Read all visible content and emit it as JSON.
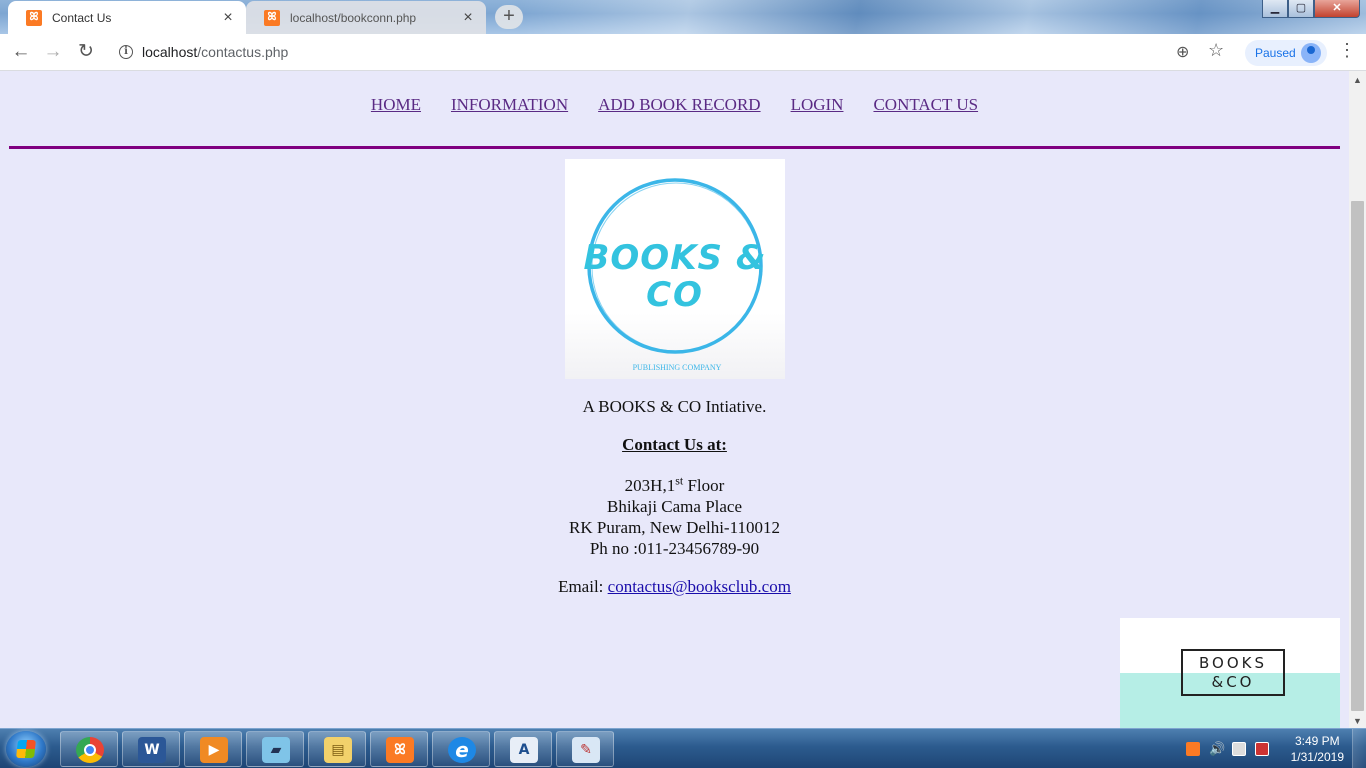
{
  "browser": {
    "tabs": [
      {
        "title": "Contact Us",
        "active": true
      },
      {
        "title": "localhost/bookconn.php",
        "active": false
      }
    ],
    "new_tab_glyph": "+",
    "window_controls": {
      "minimize": "▁",
      "maximize": "▢",
      "close": "✕"
    },
    "url_host": "localhost",
    "url_path": "/contactus.php",
    "profile_status": "Paused"
  },
  "page": {
    "nav": [
      "HOME",
      "INFORMATION",
      "ADD BOOK RECORD",
      "LOGIN",
      "CONTACT US"
    ],
    "logo": {
      "line1": "BOOKS &",
      "line2": "CO",
      "subtitle": "PUBLISHING COMPANY",
      "ring_color": "#3bb6e8"
    },
    "tagline": "A BOOKS & CO Intiative.",
    "contact_heading": "Contact Us at:",
    "address": {
      "line1_prefix": "203H,1",
      "line1_sup": "st",
      "line1_suffix": " Floor",
      "line2": "Bhikaji Cama Place",
      "line3": "RK Puram, New Delhi-110012",
      "line4": "Ph no :011-23456789-90"
    },
    "email_label": "Email: ",
    "email": "contactus@booksclub.com",
    "badge": {
      "line1": "BOOKS",
      "line2": "&CO",
      "accent_color": "#b6eee6"
    },
    "nav_color": "#5a2a84",
    "rule_color": "#800080",
    "background": "#e8e8fa"
  },
  "taskbar": {
    "apps": [
      {
        "name": "chrome",
        "glyph": "◉"
      },
      {
        "name": "word",
        "glyph": "W"
      },
      {
        "name": "media-player",
        "glyph": "▶"
      },
      {
        "name": "notepad",
        "glyph": "▰"
      },
      {
        "name": "explorer",
        "glyph": "▤"
      },
      {
        "name": "xampp",
        "glyph": "ꕤ"
      },
      {
        "name": "internet-explorer",
        "glyph": "e"
      },
      {
        "name": "wordpad",
        "glyph": "A"
      },
      {
        "name": "paint",
        "glyph": "✎"
      }
    ],
    "time": "3:49 PM",
    "date": "1/31/2019"
  }
}
